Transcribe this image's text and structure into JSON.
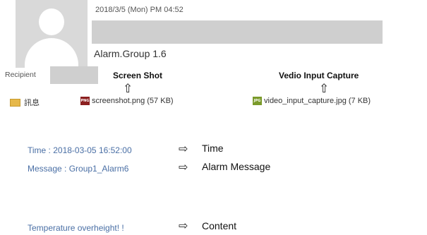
{
  "header": {
    "date": "2018/3/5 (Mon)  PM 04:52",
    "subject": "Alarm.Group 1.6",
    "recipient_label": "Recipient"
  },
  "annotations": {
    "screenshot": "Screen Shot",
    "video": "Vedio Input Capture",
    "time": "Time",
    "message": "Alarm Message",
    "content": "Content",
    "arrow_up": "⇧",
    "arrow_right": "⇨"
  },
  "attachments": {
    "message_tab": "訊息",
    "files": [
      {
        "name": "screenshot.png (57 KB)",
        "type": "PNG"
      },
      {
        "name": "video_input_capture.jpg (7 KB)",
        "type": "JPG"
      }
    ]
  },
  "body": {
    "time": "Time : 2018-03-05 16:52:00",
    "message": "Message : Group1_Alarm6",
    "content": "Temperature overheight! !"
  },
  "colors": {
    "body_text": "#4a6fa5",
    "redaction": "#cfcfcf"
  }
}
